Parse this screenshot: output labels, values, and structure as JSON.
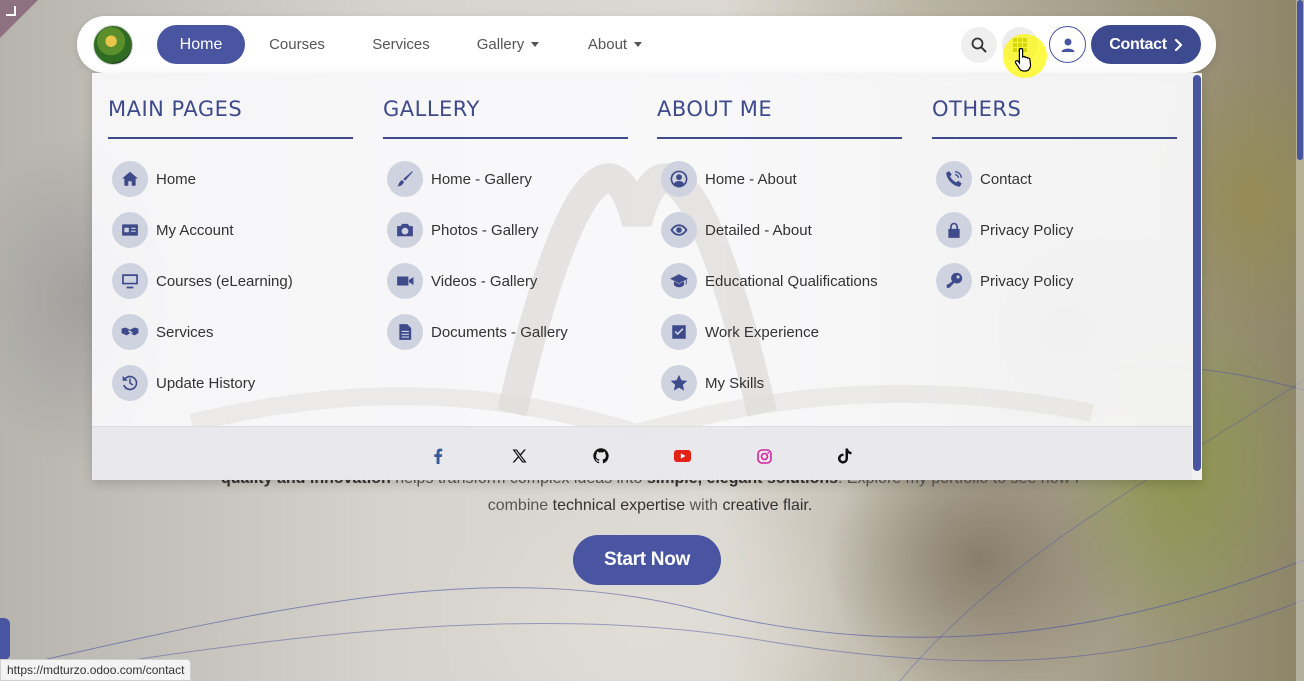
{
  "navbar": {
    "links": [
      {
        "label": "Home",
        "active": true
      },
      {
        "label": "Courses"
      },
      {
        "label": "Services"
      },
      {
        "label": "Gallery",
        "dropdown": true
      },
      {
        "label": "About",
        "dropdown": true
      }
    ],
    "contact_label": "Contact",
    "icons": [
      "search-icon",
      "apps-grid-icon",
      "user-icon"
    ]
  },
  "mega_menu": {
    "columns": [
      {
        "title": "Main Pages",
        "items": [
          {
            "label": "Home",
            "icon": "home-icon"
          },
          {
            "label": "My Account",
            "icon": "id-card-icon"
          },
          {
            "label": "Courses (eLearning)",
            "icon": "monitor-icon"
          },
          {
            "label": "Services",
            "icon": "handshake-icon"
          },
          {
            "label": "Update History",
            "icon": "history-icon"
          }
        ]
      },
      {
        "title": "Gallery",
        "items": [
          {
            "label": "Home - Gallery",
            "icon": "brush-icon"
          },
          {
            "label": "Photos - Gallery",
            "icon": "camera-icon"
          },
          {
            "label": "Videos - Gallery",
            "icon": "video-icon"
          },
          {
            "label": "Documents - Gallery",
            "icon": "document-icon"
          }
        ]
      },
      {
        "title": "About Me",
        "items": [
          {
            "label": "Home - About",
            "icon": "user-circle-icon"
          },
          {
            "label": "Detailed - About",
            "icon": "eye-icon"
          },
          {
            "label": "Educational Qualifications",
            "icon": "graduation-cap-icon"
          },
          {
            "label": "Work Experience",
            "icon": "check-square-icon"
          },
          {
            "label": "My Skills",
            "icon": "star-icon"
          }
        ]
      },
      {
        "title": "Others",
        "items": [
          {
            "label": "Contact",
            "icon": "phone-icon"
          },
          {
            "label": "Privacy Policy",
            "icon": "lock-icon"
          },
          {
            "label": "Privacy Policy",
            "icon": "key-icon"
          }
        ]
      }
    ],
    "social": [
      "facebook-icon",
      "x-icon",
      "github-icon",
      "youtube-icon",
      "instagram-icon",
      "tiktok-icon"
    ]
  },
  "hero": {
    "line1_strong1": "quality and innovation",
    "line1_text1": " helps transform complex ideas into ",
    "line1_strong2": "simple, elegant solutions",
    "line1_text2": ". Explore my portfolio to see how I",
    "line2_text1": "combine ",
    "line2_hl1": "technical expertise",
    "line2_text2": " with ",
    "line2_hl2": "creative flair.",
    "cta_label": "Start Now"
  },
  "status_bar": {
    "url": "https://mdturzo.odoo.com/contact"
  },
  "colors": {
    "primary": "#4a55a2",
    "heading": "#3f4a8a",
    "icon_bg": "#cfd3e0",
    "youtube": "#e62117",
    "instagram": "#d6249f",
    "facebook": "#3b5998"
  }
}
